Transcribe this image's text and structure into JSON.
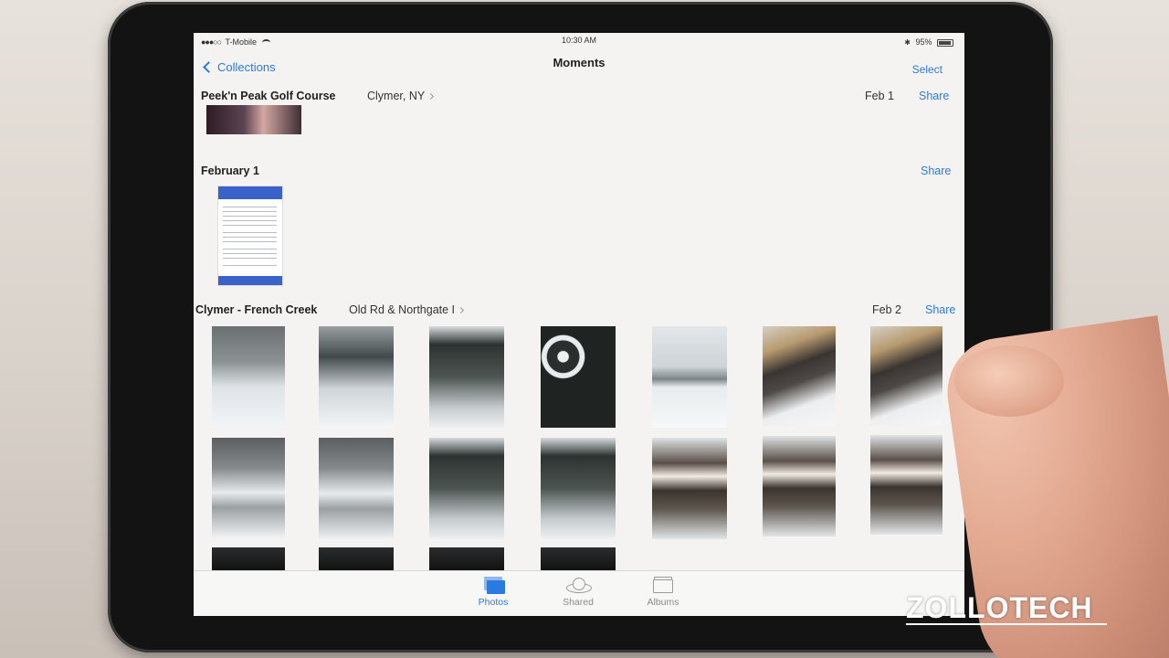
{
  "status_bar": {
    "carrier": "T-Mobile",
    "time": "10:30 AM",
    "battery": "95%"
  },
  "nav": {
    "back_label": "Collections",
    "title": "Moments",
    "select_label": "Select"
  },
  "sections": [
    {
      "title": "Peek'n Peak Golf Course",
      "location": "Clymer, NY",
      "date": "Feb 1",
      "share": "Share"
    },
    {
      "title": "February 1",
      "share": "Share"
    },
    {
      "title": "Clymer - French Creek",
      "location": "Old Rd & Northgate I",
      "date": "Feb 2",
      "share": "Share"
    }
  ],
  "tabs": [
    {
      "label": "Photos",
      "icon": "photos-icon",
      "active": true
    },
    {
      "label": "Shared",
      "icon": "cloud-icon",
      "active": false
    },
    {
      "label": "Albums",
      "icon": "albums-icon",
      "active": false
    }
  ],
  "colors": {
    "accent": "#2a7ae2",
    "bezel": "#131313",
    "screen": "#f4f3f1"
  },
  "watermark": "ZOLLOTECH"
}
